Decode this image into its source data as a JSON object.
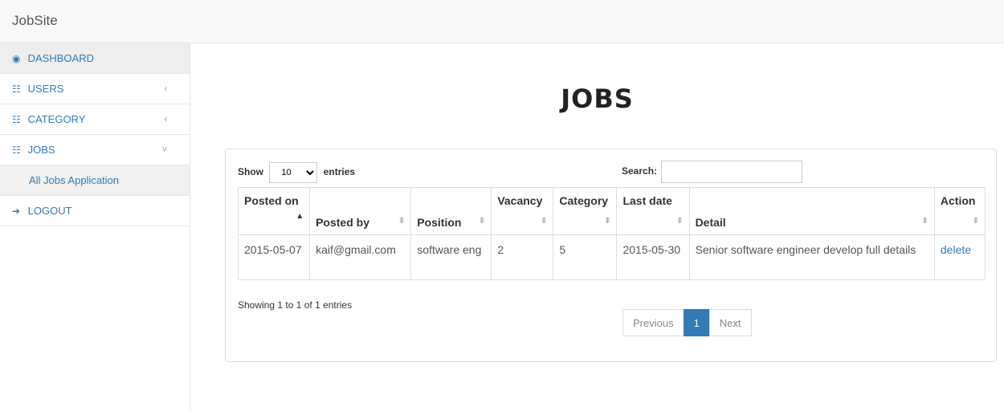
{
  "app": {
    "brand": "JobSite"
  },
  "sidebar": {
    "items": [
      {
        "icon": "dashboard-icon",
        "glyph": "◉",
        "label": "DASHBOARD"
      },
      {
        "icon": "users-icon",
        "glyph": "☷",
        "label": "USERS",
        "arrow": "‹"
      },
      {
        "icon": "category-icon",
        "glyph": "☷",
        "label": "CATEGORY",
        "arrow": "‹"
      },
      {
        "icon": "jobs-icon",
        "glyph": "☷",
        "label": "JOBS",
        "arrow": "˅"
      },
      {
        "label": "All Jobs Application"
      },
      {
        "icon": "logout-icon",
        "glyph": "➔",
        "label": "LOGOUT"
      }
    ]
  },
  "main": {
    "title": "JOBS"
  },
  "table_controls": {
    "show_label": "Show",
    "page_size": "10",
    "entries_label": "entries",
    "search_label": "Search:",
    "search_value": ""
  },
  "table": {
    "headers": [
      "Posted on",
      "Posted by",
      "Position",
      "Vacancy",
      "Category",
      "Last date",
      "Detail",
      "Action"
    ],
    "rows": [
      {
        "posted_on": "2015-05-07",
        "posted_by": "kaif@gmail.com",
        "position": "software eng",
        "vacancy": "2",
        "category": "5",
        "last_date": "2015-05-30",
        "detail": "Senior software engineer develop full details",
        "action": "delete"
      }
    ]
  },
  "footer": {
    "info": "Showing 1 to 1 of 1 entries",
    "previous": "Previous",
    "page": "1",
    "next": "Next"
  },
  "colors": {
    "link": "#337ab7",
    "active_page": "#337ab7",
    "navbar_bg": "#f8f8f8"
  }
}
